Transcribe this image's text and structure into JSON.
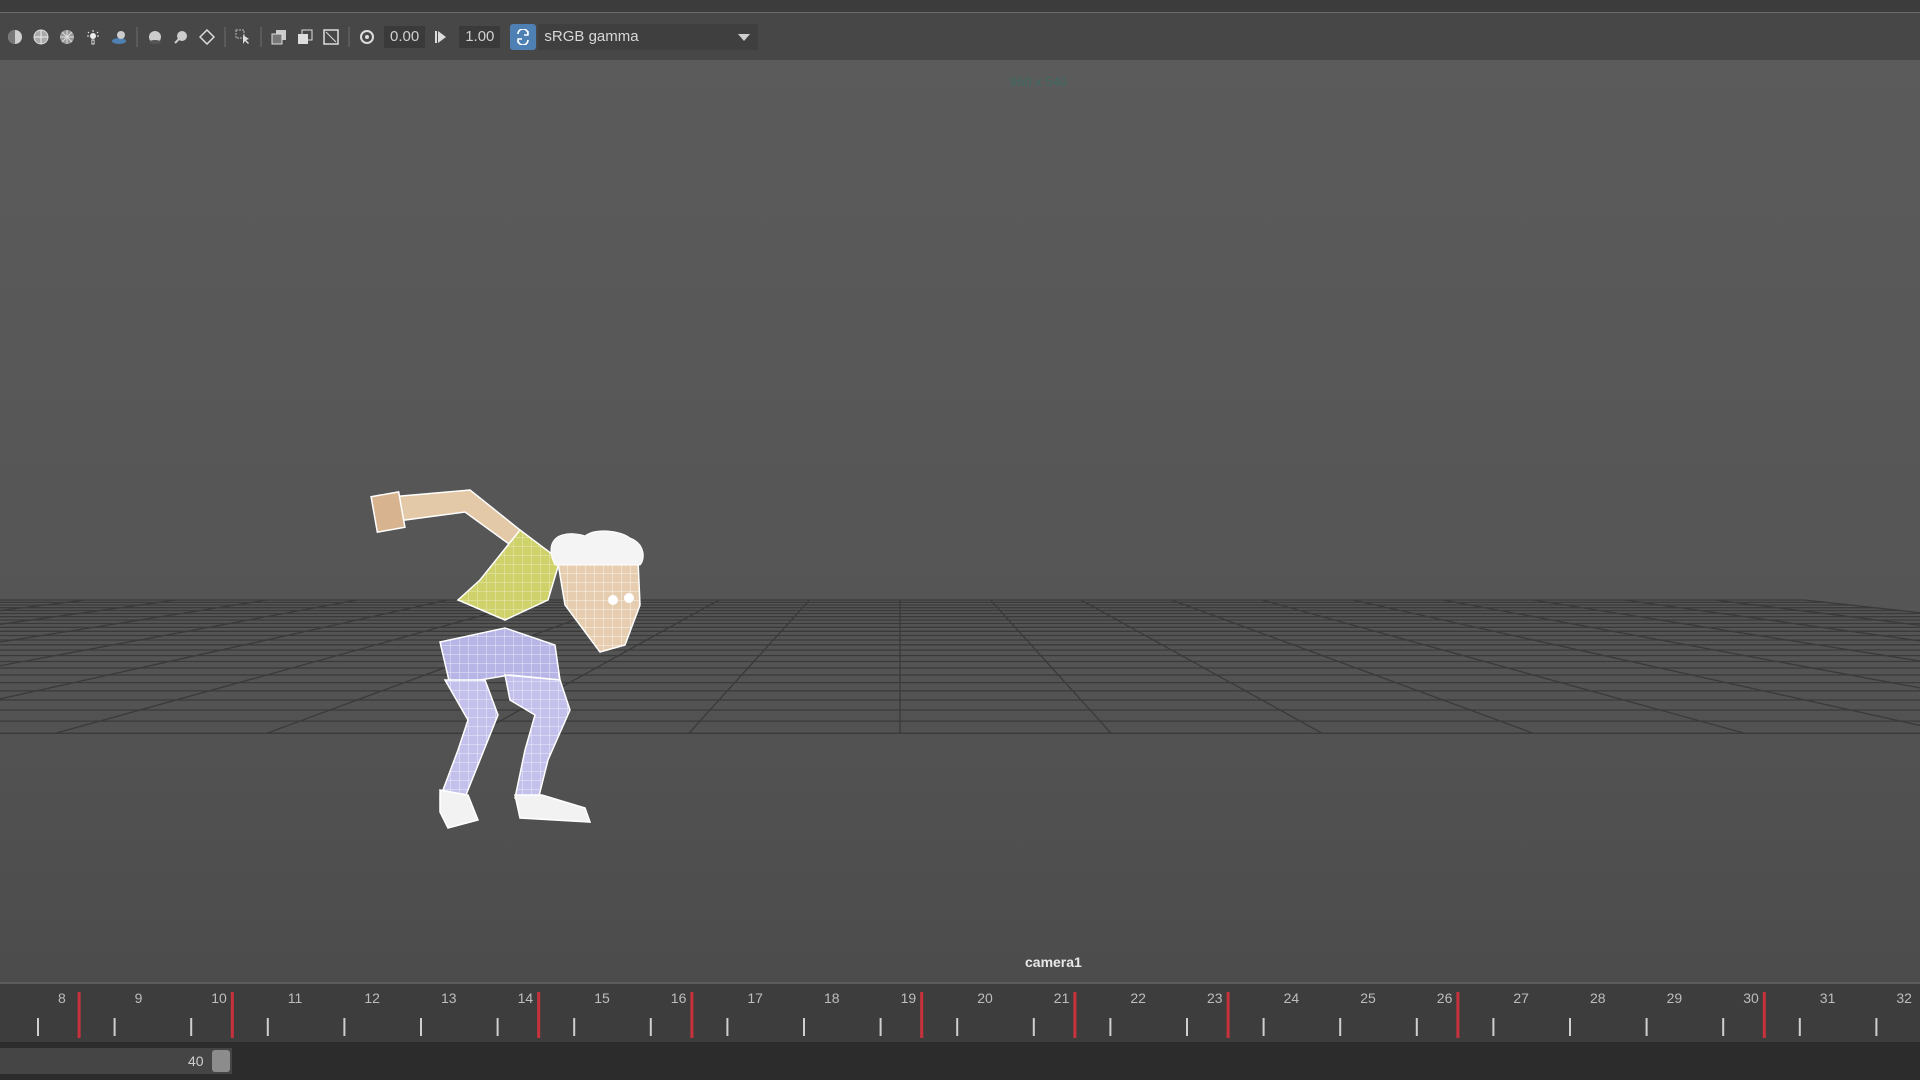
{
  "toolbar": {
    "exposure_value": "0.00",
    "gamma_value": "1.00",
    "color_management_option": "sRGB gamma",
    "icons": [
      "shade-icon",
      "wireframe-shade-icon",
      "textured-icon",
      "lighting-icon",
      "shadow-icon",
      "sphere-icon",
      "sphere-alt-icon",
      "isolate-icon",
      "select-icon",
      "camera-gate-icon",
      "resolution-gate-icon",
      "frame-icon",
      "exposure-icon",
      "gamma-icon",
      "color-management-icon"
    ]
  },
  "viewport": {
    "resolution_label": "960 x 540",
    "camera_label": "camera1"
  },
  "timeline": {
    "frames": [
      "8",
      "9",
      "10",
      "11",
      "12",
      "13",
      "14",
      "15",
      "16",
      "17",
      "18",
      "19",
      "20",
      "21",
      "22",
      "23",
      "24",
      "25",
      "26",
      "27",
      "28",
      "29",
      "30",
      "31",
      "32"
    ],
    "keyframes": [
      9,
      11,
      15,
      17,
      20,
      22,
      24,
      27,
      31
    ]
  },
  "range": {
    "end_value": "40"
  },
  "colors": {
    "accent": "#4e80b3",
    "keyframe": "#c8323c",
    "grid": "#3a3a3a"
  }
}
